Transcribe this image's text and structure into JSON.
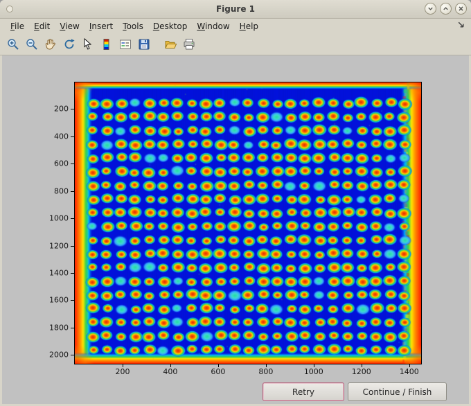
{
  "window": {
    "title": "Figure 1"
  },
  "menubar": {
    "items": [
      {
        "label": "File"
      },
      {
        "label": "Edit"
      },
      {
        "label": "View"
      },
      {
        "label": "Insert"
      },
      {
        "label": "Tools"
      },
      {
        "label": "Desktop"
      },
      {
        "label": "Window"
      },
      {
        "label": "Help"
      }
    ]
  },
  "toolbar": {
    "buttons": [
      {
        "icon": "zoom-in-icon"
      },
      {
        "icon": "zoom-out-icon"
      },
      {
        "icon": "pan-hand-icon"
      },
      {
        "icon": "rotate-3d-icon"
      },
      {
        "icon": "data-cursor-icon"
      },
      {
        "icon": "insert-colorbar-icon"
      },
      {
        "icon": "insert-legend-icon"
      },
      {
        "icon": "save-icon"
      },
      {
        "icon": "open-folder-icon"
      },
      {
        "icon": "print-icon"
      }
    ]
  },
  "figure": {
    "buttons": {
      "retry": "Retry",
      "continue_finish": "Continue / Finish"
    }
  },
  "chart_data": {
    "type": "heatmap",
    "title": "",
    "description": "Pseudocolor (jet colormap) scan of a microarray slide: regular grid of red/orange spots with yellow-green halos on a deep blue background; saturated red-orange-yellow fringes along the slide edges and corners",
    "x_ticks": [
      200,
      400,
      600,
      800,
      1000,
      1200,
      1400
    ],
    "y_ticks": [
      200,
      400,
      600,
      800,
      1000,
      1200,
      1400,
      1600,
      1800,
      2000
    ],
    "x_range": [
      0,
      1450
    ],
    "y_range": [
      0,
      2060
    ],
    "grid": {
      "rows": 19,
      "cols": 23
    },
    "legend": false,
    "grid_lines": false,
    "colors": {
      "background": "#0312dc",
      "spot_core": "#e02800",
      "spot_mid": "#ff6a00",
      "spot_ring": "#ffd800",
      "spot_halo": "#3ed44e",
      "spot_outer": "#00a8f0",
      "variant_spot": "#20e0a0",
      "edge_hot": "#ff1e00",
      "edge_warm": "#ff8a00",
      "edge_yellow": "#ffe400",
      "edge_green": "#2fd24f",
      "edge_cyan": "#00b4ff"
    }
  }
}
